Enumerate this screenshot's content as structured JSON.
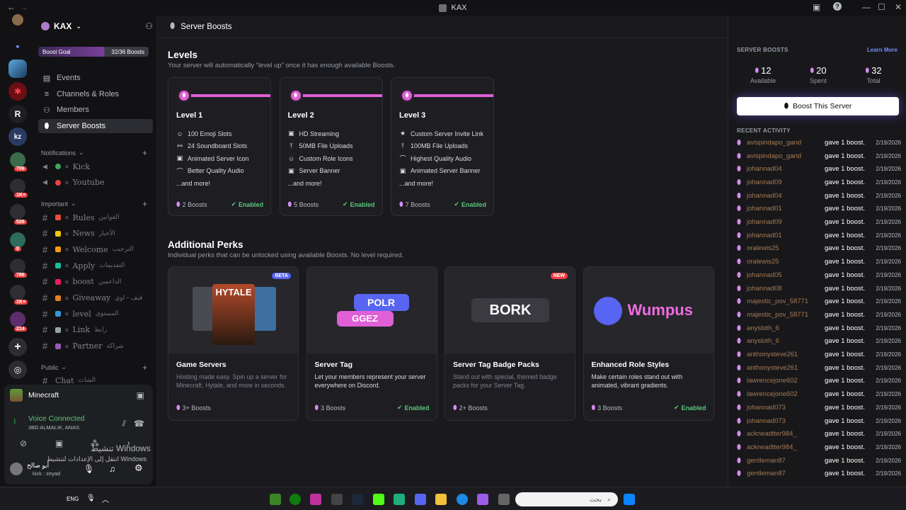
{
  "window": {
    "title": "KAX"
  },
  "server": {
    "name": "KAX",
    "boost_goal_label": "Boost Goal",
    "boost_goal_value": "32/36 Boosts",
    "boost_goal_progress": 0.89
  },
  "nav": [
    {
      "label": "Events",
      "icon": "calendar-icon"
    },
    {
      "label": "Channels & Roles",
      "icon": "list-icon"
    },
    {
      "label": "Members",
      "icon": "members-icon"
    },
    {
      "label": "Server Boosts",
      "icon": "boost-icon",
      "active": true
    }
  ],
  "categories": {
    "notifications": "Notifications",
    "important": "Important",
    "public": "Public"
  },
  "notif_channels": [
    {
      "label": "Kick",
      "color": "#3ba55c"
    },
    {
      "label": "Youtube",
      "color": "#ed4245"
    }
  ],
  "important_channels": [
    {
      "label": "Rules",
      "ar": "القوانين"
    },
    {
      "label": "News",
      "ar": "الأخبار"
    },
    {
      "label": "Welcome",
      "ar": "الترحيب"
    },
    {
      "label": "Apply",
      "ar": "التقديمات"
    },
    {
      "label": "boost",
      "ar": "الداعمين"
    },
    {
      "label": "Giveaway",
      "ar": "قيف - اوي"
    },
    {
      "label": "level",
      "ar": "المستوى"
    },
    {
      "label": "Link",
      "ar": "رابط"
    },
    {
      "label": "Partner",
      "ar": "شراكة"
    }
  ],
  "public_channels": [
    {
      "label": "Chat",
      "ar": "الشات"
    }
  ],
  "guild_badges": [
    "706",
    "1K+",
    "526",
    "8",
    "786",
    "1K+",
    "214"
  ],
  "voice": {
    "activity": "Minecraft",
    "status": "Voice Connected",
    "channel": "3BD ALMALIK, ANAS"
  },
  "user": {
    "name": "أبو صالح",
    "status": "kick : zeyad"
  },
  "header": {
    "title": "Server Boosts"
  },
  "levels_section": {
    "title": "Levels",
    "subtitle": "Your server will automatically “level up” once it has enough available Boosts."
  },
  "levels": [
    {
      "title": "Level 1",
      "perks": [
        "100 Emoji Slots",
        "24 Soundboard Slots",
        "Animated Server Icon",
        "Better Quality Audio",
        "...and more!"
      ],
      "boosts": "2 Boosts",
      "status": "Enabled"
    },
    {
      "title": "Level 2",
      "perks": [
        "HD Streaming",
        "50MB File Uploads",
        "Custom Role Icons",
        "Server Banner",
        "...and more!"
      ],
      "boosts": "5 Boosts",
      "status": "Enabled"
    },
    {
      "title": "Level 3",
      "perks": [
        "Custom Server Invite Link",
        "100MB File Uploads",
        "Highest Quality Audio",
        "Animated Server Banner",
        "...and more!"
      ],
      "boosts": "7 Boosts",
      "status": "Enabled"
    }
  ],
  "perks_section": {
    "title": "Additional Perks",
    "subtitle": "Individual perks that can be unlocked using available Boosts. No level required."
  },
  "perks": [
    {
      "title": "Game Servers",
      "desc": "Hosting made easy. Spin up a server for Minecraft, Hytale, and more in seconds.",
      "boosts": "3+ Boosts",
      "status": "",
      "tag": "BETA",
      "art": "HYTALE"
    },
    {
      "title": "Server Tag",
      "desc": "Let your members represent your server everywhere on Discord.",
      "boosts": "3 Boosts",
      "status": "Enabled",
      "tag": "",
      "art": "POLR"
    },
    {
      "title": "Server Tag Badge Packs",
      "desc": "Stand out with special, themed badge packs for your Server Tag.",
      "boosts": "2+ Boosts",
      "status": "",
      "tag": "NEW",
      "art": "BORK"
    },
    {
      "title": "Enhanced Role Styles",
      "desc": "Make certain roles stand out with animated, vibrant gradients.",
      "boosts": "3 Boosts",
      "status": "Enabled",
      "tag": "",
      "art": "Wumpus"
    }
  ],
  "art_extra": {
    "ggez": "GGEZ"
  },
  "right": {
    "title": "SERVER BOOSTS",
    "learn_more": "Learn More",
    "boost_button": "Boost This Server",
    "recent_title": "RECENT ACTIVITY",
    "stats": [
      {
        "value": "12",
        "label": "Available"
      },
      {
        "value": "20",
        "label": "Spent"
      },
      {
        "value": "32",
        "label": "Total"
      }
    ],
    "activity": [
      {
        "user": "avispindapo_gand",
        "text": "gave 1 boost.",
        "date": "2/19/2026"
      },
      {
        "user": "avispindapo_gand",
        "text": "gave 1 boost.",
        "date": "2/19/2026"
      },
      {
        "user": "johannad04",
        "text": "gave 1 boost.",
        "date": "2/19/2026"
      },
      {
        "user": "johannad09",
        "text": "gave 1 boost.",
        "date": "2/19/2026"
      },
      {
        "user": "johannad04",
        "text": "gave 1 boost.",
        "date": "2/19/2026"
      },
      {
        "user": "johannad01",
        "text": "gave 1 boost.",
        "date": "2/19/2026"
      },
      {
        "user": "johannad09",
        "text": "gave 1 boost.",
        "date": "2/19/2026"
      },
      {
        "user": "johannad01",
        "text": "gave 1 boost.",
        "date": "2/19/2026"
      },
      {
        "user": "oralewis25",
        "text": "gave 1 boost.",
        "date": "2/19/2026"
      },
      {
        "user": "oralewis25",
        "text": "gave 1 boost.",
        "date": "2/19/2026"
      },
      {
        "user": "johannad05",
        "text": "gave 1 boost.",
        "date": "2/19/2026"
      },
      {
        "user": "johannad08",
        "text": "gave 1 boost.",
        "date": "2/19/2026"
      },
      {
        "user": "majestic_pov_58771",
        "text": "gave 1 boost.",
        "date": "2/19/2026"
      },
      {
        "user": "majestic_pov_58771",
        "text": "gave 1 boost.",
        "date": "2/19/2026"
      },
      {
        "user": "anysloth_6",
        "text": "gave 1 boost.",
        "date": "2/19/2026"
      },
      {
        "user": "anysloth_6",
        "text": "gave 1 boost.",
        "date": "2/19/2026"
      },
      {
        "user": "anthonysteve261",
        "text": "gave 1 boost.",
        "date": "2/19/2026"
      },
      {
        "user": "anthonysteve261",
        "text": "gave 1 boost.",
        "date": "2/19/2026"
      },
      {
        "user": "lawrencejone602",
        "text": "gave 1 boost.",
        "date": "2/19/2026"
      },
      {
        "user": "lawrencejone602",
        "text": "gave 1 boost.",
        "date": "2/19/2026"
      },
      {
        "user": "johannad073",
        "text": "gave 1 boost.",
        "date": "2/19/2026"
      },
      {
        "user": "johannad073",
        "text": "gave 1 boost.",
        "date": "2/19/2026"
      },
      {
        "user": "ackneadtter984_",
        "text": "gave 1 boost.",
        "date": "2/19/2026"
      },
      {
        "user": "ackneadtter984_",
        "text": "gave 1 boost.",
        "date": "2/19/2026"
      },
      {
        "user": "gentleman87",
        "text": "gave 1 boost.",
        "date": "2/19/2026"
      },
      {
        "user": "gentleman87",
        "text": "gave 1 boost.",
        "date": "2/19/2026"
      }
    ]
  },
  "watermark": {
    "line1": "تنشيط Windows",
    "line2": "انتقل إلى الإعدادات لتنشيط Windows"
  },
  "taskbar": {
    "search_placeholder": "بحث",
    "lang": "ENG"
  },
  "colors": {
    "accent": "#e05fd6",
    "enabled": "#58c77a",
    "button": "#ffffff"
  }
}
